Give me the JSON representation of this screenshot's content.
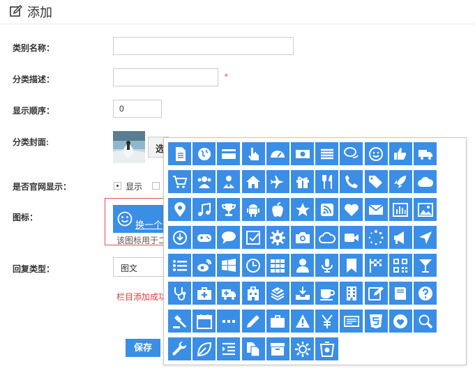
{
  "header": {
    "title": "添加"
  },
  "form": {
    "category_name_label": "类别名称：",
    "category_name_value": "",
    "description_label": "分类描述：",
    "description_value": "",
    "required_mark": "*",
    "order_label": "显示顺序：",
    "order_value": "0",
    "cover_label": "分类封面:",
    "select_button_label": "选",
    "official_display_label": "是否官网显示：",
    "display_option_label": "显示",
    "icon_label": "图标：",
    "change_icon_label": "换一个",
    "icon_hint": "该图标用于二",
    "reply_type_label": "回复类型：",
    "reply_type_value": "图文",
    "notice": "栏目添加成功",
    "save_label": "保存"
  },
  "colors": {
    "accent": "#3a8ee6",
    "error": "#e4393c"
  },
  "icon_picker": {
    "rows": [
      [
        "file-text-icon",
        "globe-icon",
        "credit-card-icon",
        "hand-pointer-icon",
        "dashboard-icon",
        "money-icon",
        "list-icon",
        "comments-icon",
        "smile-icon",
        "thumbs-up-icon",
        "truck-icon"
      ],
      [
        "shopping-cart-icon",
        "users-icon",
        "user-md-icon",
        "home-icon",
        "plane-icon",
        "gift-icon",
        "cutlery-icon",
        "phone-icon",
        "tags-icon",
        "rocket-icon",
        "cloud-icon"
      ],
      [
        "map-marker-icon",
        "music-icon",
        "trophy-icon",
        "android-icon",
        "apple-icon",
        "star-icon",
        "rss-square-icon",
        "heart-icon",
        "envelope-icon",
        "bar-chart-icon",
        "picture-icon"
      ],
      [
        "download-circle-icon",
        "gamepad-icon",
        "comment-icon",
        "check-square-icon",
        "cog-icon",
        "camera-icon",
        "cloud-outline-icon",
        "video-camera-icon",
        "spinner-icon",
        "bullhorn-icon",
        "location-arrow-icon"
      ],
      [
        "list-ul-icon",
        "weibo-icon",
        "windows-icon",
        "clock-icon",
        "th-icon",
        "user-icon",
        "microphone-icon",
        "bookmark-icon",
        "flag-checkered-icon",
        "qrcode-icon",
        "glass-icon"
      ],
      [
        "stethoscope-icon",
        "medkit-icon",
        "ambulance-icon",
        "hospital-icon",
        "check-stack-icon",
        "inbox-download-icon",
        "coffee-icon",
        "building-icon",
        "edit-icon",
        "book-icon",
        "question-circle-icon"
      ],
      [
        "gavel-icon",
        "calendar-icon",
        "ellipsis-icon",
        "pencil-icon",
        "briefcase-icon",
        "warning-icon",
        "yen-icon",
        "credit-card-alt-icon",
        "html5-icon",
        "heart-circle-icon",
        "search-icon"
      ],
      [
        "wrench-icon",
        "leaf-icon",
        "indent-icon",
        "files-icon",
        "archive-icon",
        "sun-icon",
        "trash-icon"
      ]
    ]
  }
}
